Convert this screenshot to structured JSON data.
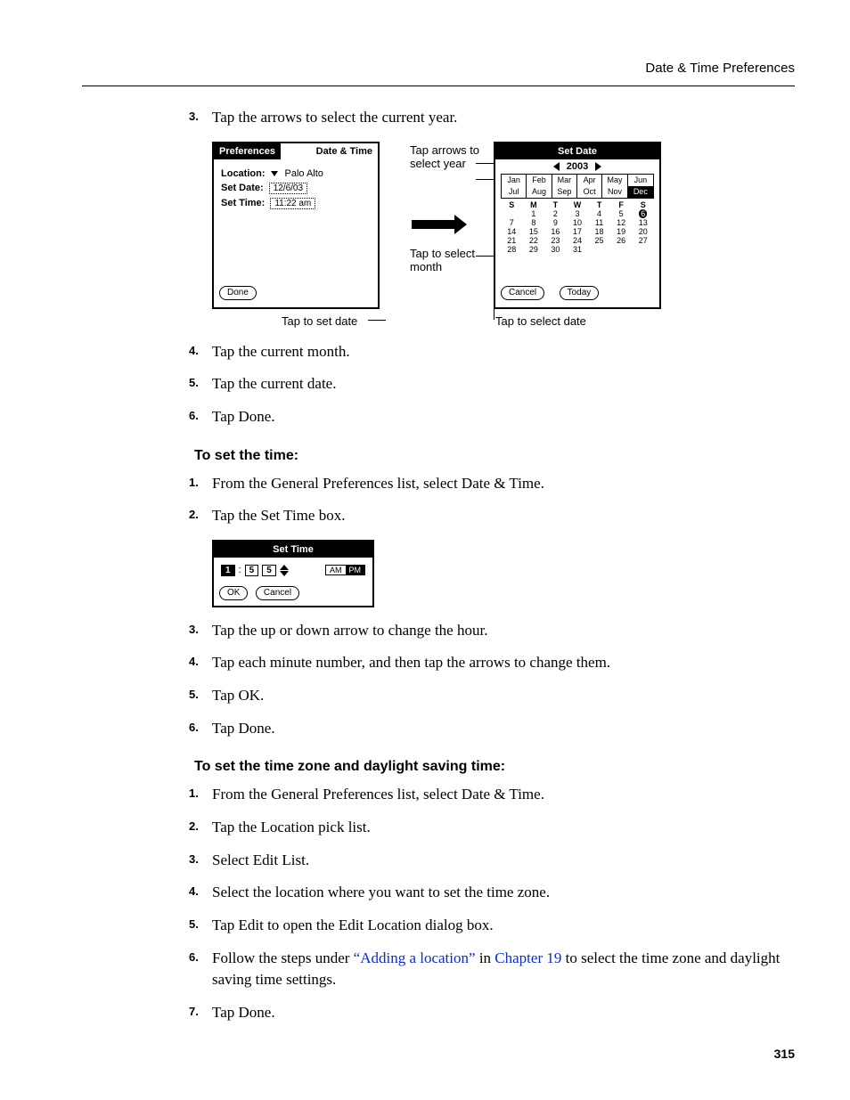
{
  "header": {
    "section_title": "Date & Time Preferences"
  },
  "page_number": "315",
  "steps_a": {
    "s3": "Tap the arrows to select the current year.",
    "s4": "Tap the current month.",
    "s5": "Tap the current date.",
    "s6": "Tap Done."
  },
  "heading_time": "To set the time:",
  "steps_time": {
    "s1": "From the General Preferences list, select Date & Time.",
    "s2": "Tap the Set Time box.",
    "s3": "Tap the up or down arrow to change the hour.",
    "s4": "Tap each minute number, and then tap the arrows to change them.",
    "s5": "Tap OK.",
    "s6": "Tap Done."
  },
  "heading_zone": "To set the time zone and daylight saving time:",
  "steps_zone": {
    "s1": "From the General Preferences list, select Date & Time.",
    "s2": "Tap the Location pick list.",
    "s3": "Select Edit List.",
    "s4": "Select the location where you want to set the time zone.",
    "s5": "Tap Edit to open the Edit Location dialog box.",
    "s6_a": "Follow the steps under ",
    "s6_link1": "“Adding a location”",
    "s6_mid": " in ",
    "s6_link2": "Chapter 19",
    "s6_b": " to select the time zone and daylight saving time settings.",
    "s7": "Tap Done."
  },
  "fig1": {
    "prefs": {
      "title_left": "Preferences",
      "title_right": "Date & Time",
      "loc_label": "Location:",
      "loc_value": "Palo Alto",
      "date_label": "Set Date:",
      "date_value": "12/6/03",
      "time_label": "Set Time:",
      "time_value": "11:22 am",
      "done": "Done"
    },
    "annot": {
      "year": "Tap arrows to select year",
      "month": "Tap to select month",
      "setdate_caption": "Tap to set date",
      "selectdate_caption": "Tap to select date"
    },
    "setdate": {
      "title": "Set Date",
      "year": "2003",
      "months": [
        "Jan",
        "Feb",
        "Mar",
        "Apr",
        "May",
        "Jun",
        "Jul",
        "Aug",
        "Sep",
        "Oct",
        "Nov",
        "Dec"
      ],
      "dow": [
        "S",
        "M",
        "T",
        "W",
        "T",
        "F",
        "S"
      ],
      "selected_month": "Dec",
      "selected_day": "6",
      "cancel": "Cancel",
      "today": "Today"
    }
  },
  "fig2": {
    "title": "Set Time",
    "hour": "1",
    "min1": "5",
    "min2": "5",
    "am": "AM",
    "pm": "PM",
    "ok": "OK",
    "cancel": "Cancel"
  }
}
